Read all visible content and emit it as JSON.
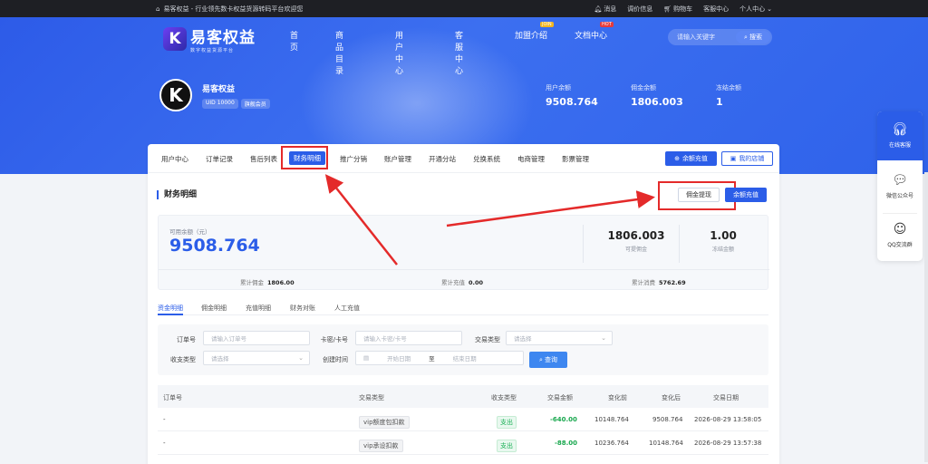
{
  "topbar": {
    "site_text": "易客权益 - 行业领先数卡权益货源转码平台欢迎您",
    "links": [
      "消息",
      "调价信息",
      "购物车",
      "客服中心",
      "个人中心"
    ]
  },
  "header": {
    "logo_letter": "K",
    "logo_title": "易客权益",
    "logo_sub": "数字权益货源平台",
    "nav": [
      "首页",
      "商品目录",
      "用户中心",
      "客服中心",
      "加盟介绍",
      "文档中心"
    ],
    "nav_badges": {
      "join": "JOIN",
      "doc": "HOT"
    },
    "search_placeholder": "请输入关键字",
    "search_button": "搜索"
  },
  "profile": {
    "avatar_letter": "K",
    "name": "易客权益",
    "uid": "UID 10000",
    "level": "旗舰会员",
    "stats": [
      {
        "label": "用户余额",
        "value": "9508.764"
      },
      {
        "label": "佣金余额",
        "value": "1806.003"
      },
      {
        "label": "冻结余额",
        "value": "1"
      }
    ]
  },
  "tabs": [
    "用户中心",
    "订单记录",
    "售后列表",
    "财务明细",
    "推广分销",
    "账户管理",
    "开通分站",
    "兑换系统",
    "电商管理",
    "影票管理"
  ],
  "tab_buttons": {
    "recharge": "余额充值",
    "store": "我的店铺"
  },
  "finance": {
    "title": "财务明细",
    "withdraw": "佣金提现",
    "recharge": "余额充值",
    "available_label": "可用余额（元）",
    "available_value": "9508.764",
    "commission_value": "1806.003",
    "commission_label": "可提佣金",
    "frozen_value": "1.00",
    "frozen_label": "冻结金额",
    "totals": [
      {
        "label": "累计佣金",
        "value": "1806.00"
      },
      {
        "label": "累计充值",
        "value": "0.00"
      },
      {
        "label": "累计消费",
        "value": "5762.69"
      }
    ]
  },
  "subtabs": [
    "资金明细",
    "佣金明细",
    "充值明细",
    "财务对账",
    "人工充值"
  ],
  "filters": {
    "order_label": "订单号",
    "order_ph": "请输入订单号",
    "card_label": "卡密/卡号",
    "card_ph": "请输入卡密/卡号",
    "trade_label": "交易类型",
    "trade_ph": "请选择",
    "io_label": "收支类型",
    "io_ph": "请选择",
    "time_label": "创建时间",
    "start_ph": "开始日期",
    "to": "至",
    "end_ph": "结束日期",
    "query": "查询"
  },
  "table": {
    "headers": [
      "订单号",
      "交易类型",
      "收支类型",
      "交易金额",
      "变化前",
      "变化后",
      "交易日期"
    ],
    "rows": [
      {
        "order": "-",
        "type": "vip额度包扣款",
        "io": "支出",
        "amount": "-640.00",
        "before": "10148.764",
        "after": "9508.764",
        "date": "2026-08-29 13:58:05"
      },
      {
        "order": "-",
        "type": "vip承设扣款",
        "io": "支出",
        "amount": "-88.00",
        "before": "10236.764",
        "after": "10148.764",
        "date": "2026-08-29 13:57:38"
      }
    ]
  },
  "side": {
    "service": "在线客服",
    "wechat": "微信公众号",
    "qq": "QQ交流群"
  },
  "colors": {
    "primary": "#2b5de8",
    "annotation": "#e42a2a",
    "out": "#1bb157"
  }
}
